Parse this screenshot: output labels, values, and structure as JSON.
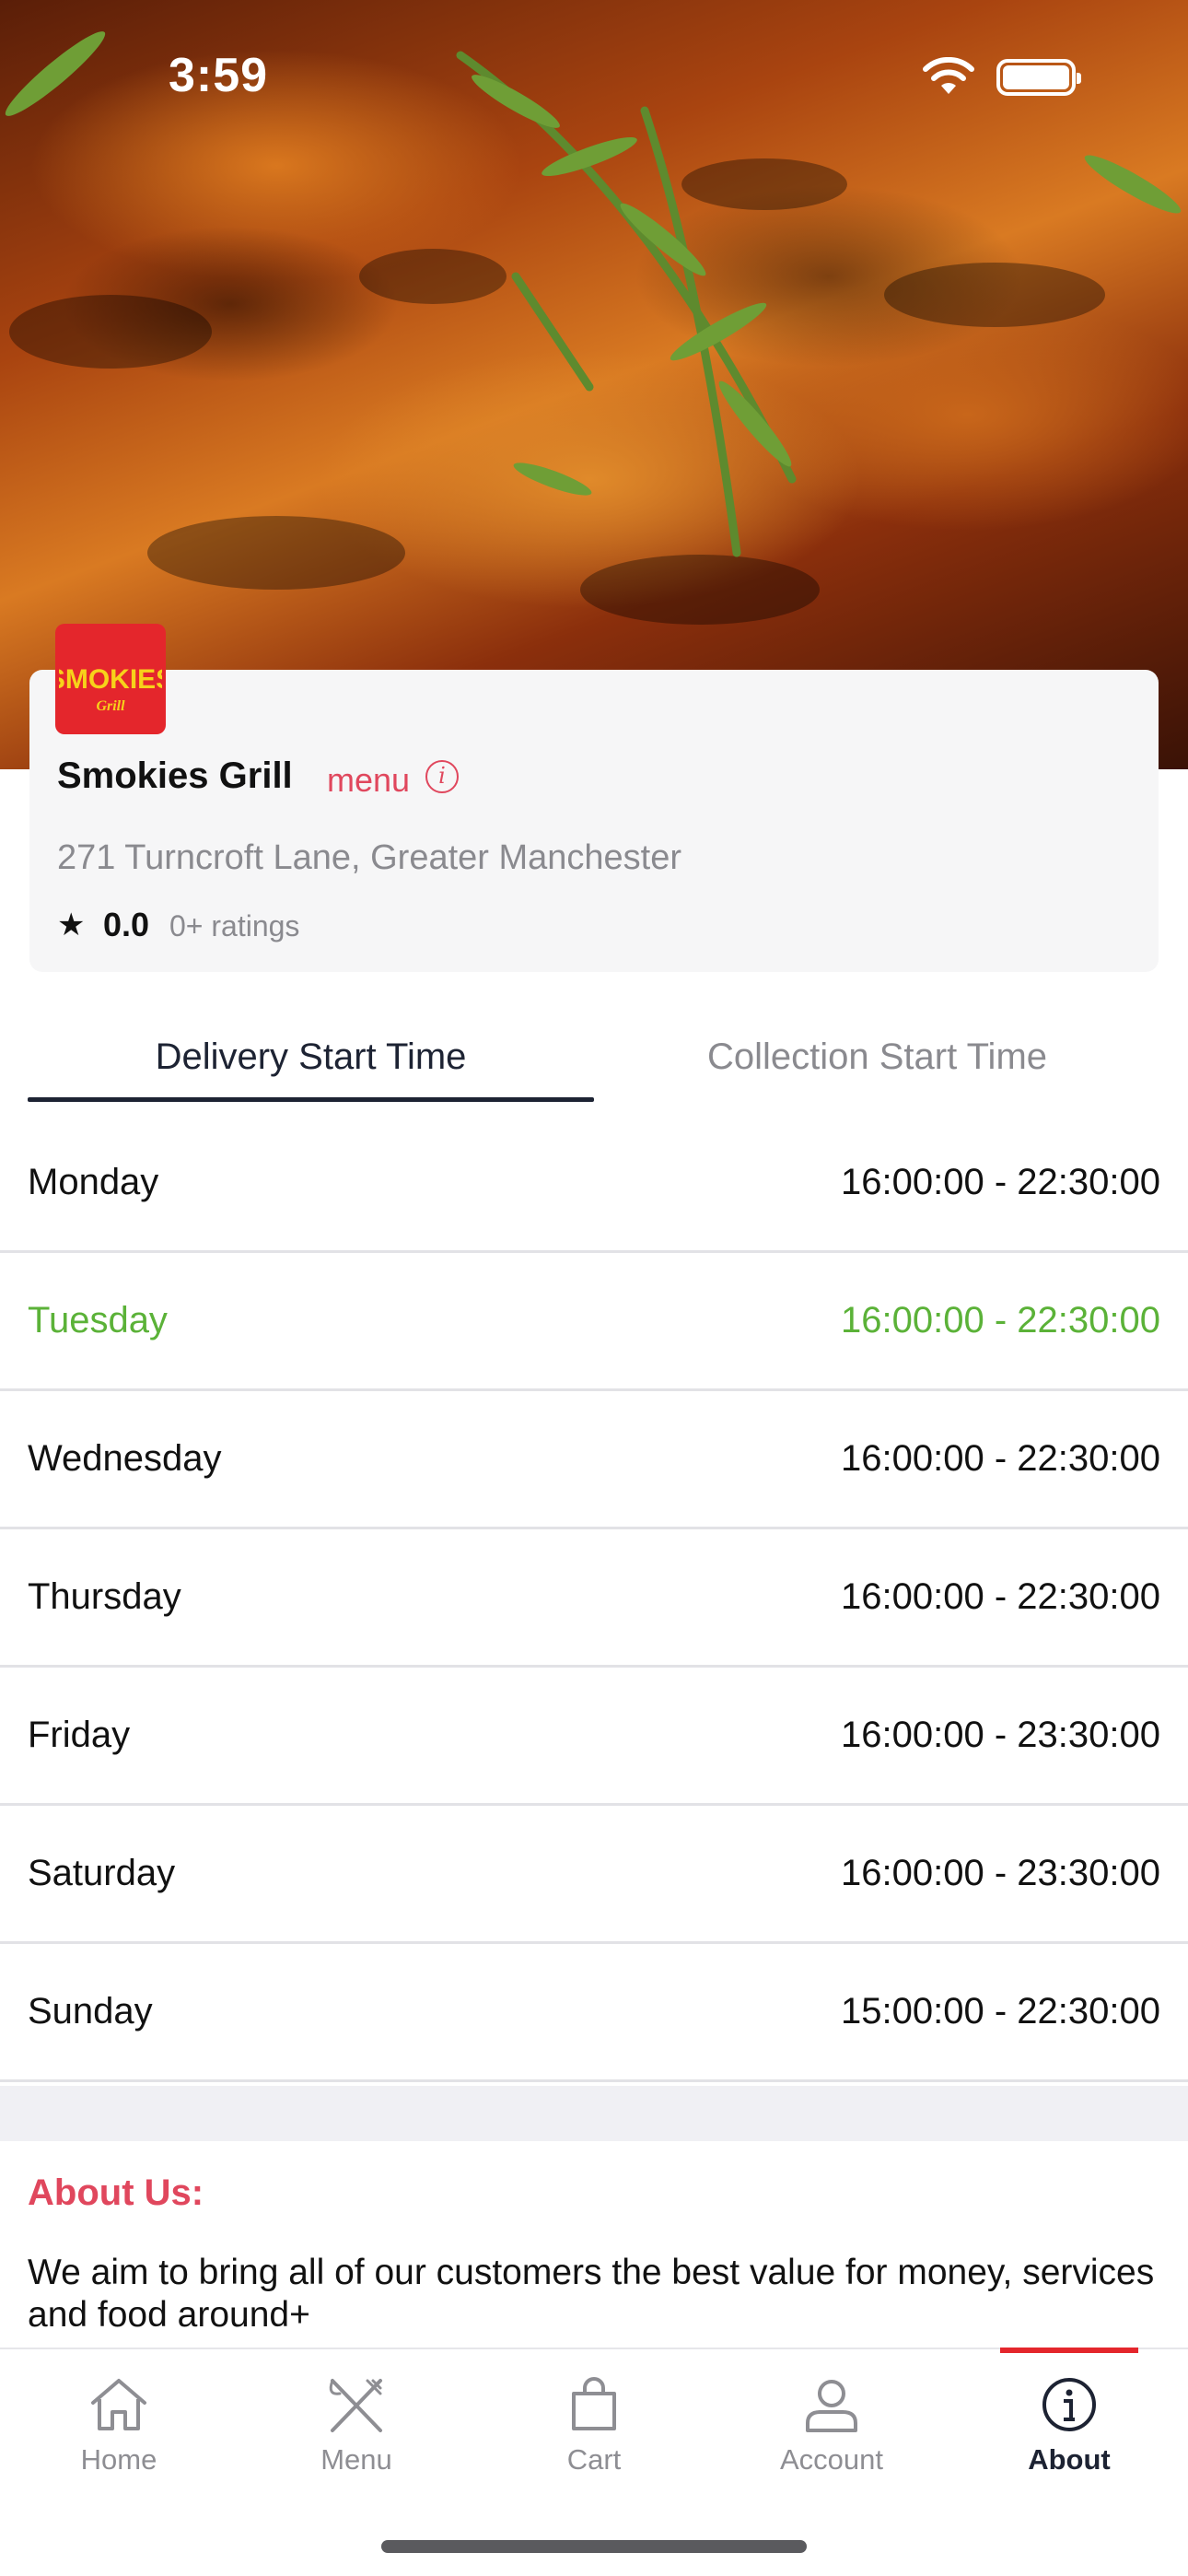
{
  "status_bar": {
    "time": "3:59"
  },
  "restaurant": {
    "logo_text": "SMOKIES",
    "logo_subtext": "Grill",
    "name": "Smokies Grill",
    "menu_link": "menu",
    "address": "271 Turncroft Lane, Greater Manchester",
    "rating": "0.0",
    "rating_count": "0+ ratings"
  },
  "tabs": [
    {
      "label": "Delivery Start Time",
      "active": true
    },
    {
      "label": "Collection Start Time",
      "active": false
    }
  ],
  "schedule": [
    {
      "day": "Monday",
      "hours": "16:00:00 - 22:30:00"
    },
    {
      "day": "Tuesday",
      "hours": "16:00:00 - 22:30:00",
      "today": true
    },
    {
      "day": "Wednesday",
      "hours": "16:00:00 - 22:30:00"
    },
    {
      "day": "Thursday",
      "hours": "16:00:00 - 22:30:00"
    },
    {
      "day": "Friday",
      "hours": "16:00:00 - 23:30:00"
    },
    {
      "day": "Saturday",
      "hours": "16:00:00 - 23:30:00"
    },
    {
      "day": "Sunday",
      "hours": "15:00:00 - 22:30:00"
    }
  ],
  "about": {
    "title": "About Us:",
    "text": "We aim to bring all of our customers the best value for money, services and food around+"
  },
  "tabbar": [
    {
      "label": "Home",
      "icon": "home-icon"
    },
    {
      "label": "Menu",
      "icon": "fork-knife-icon"
    },
    {
      "label": "Cart",
      "icon": "bag-icon"
    },
    {
      "label": "Account",
      "icon": "person-icon"
    },
    {
      "label": "About",
      "icon": "info-icon",
      "active": true
    }
  ],
  "colors": {
    "accent": "#e0475d",
    "today": "#5bb238",
    "active_tab": "#1d2333",
    "brand_red": "#e4262c"
  }
}
